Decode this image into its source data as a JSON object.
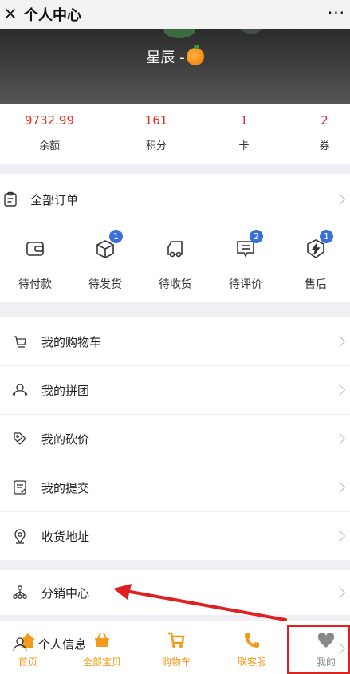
{
  "titlebar": {
    "close_icon": "×",
    "title": "个人中心",
    "more": "···"
  },
  "profile": {
    "nickname": "星辰 -"
  },
  "stats": [
    {
      "value": "9732.99",
      "label": "余额"
    },
    {
      "value": "161",
      "label": "积分"
    },
    {
      "value": "1",
      "label": "卡"
    },
    {
      "value": "2",
      "label": "券"
    }
  ],
  "orders_header": {
    "label": "全部订单"
  },
  "orders": [
    {
      "label": "待付款",
      "badge": ""
    },
    {
      "label": "待发货",
      "badge": "1"
    },
    {
      "label": "待收货",
      "badge": ""
    },
    {
      "label": "待评价",
      "badge": "2"
    },
    {
      "label": "售后",
      "badge": "1"
    }
  ],
  "menu": [
    {
      "label": "我的购物车"
    },
    {
      "label": "我的拼团"
    },
    {
      "label": "我的砍价"
    },
    {
      "label": "我的提交"
    },
    {
      "label": "收货地址"
    }
  ],
  "distribution": {
    "label": "分销中心"
  },
  "personal_info": {
    "label": "个人信息"
  },
  "tabs": [
    {
      "label": "首页"
    },
    {
      "label": "全部宝贝"
    },
    {
      "label": "购物车"
    },
    {
      "label": "联客服"
    },
    {
      "label": "我的"
    }
  ],
  "colors": {
    "accent": "#e02e24",
    "tab_orange": "#f29a1b",
    "badge_blue": "#3a6fd8",
    "annotation_red": "#e02020"
  }
}
